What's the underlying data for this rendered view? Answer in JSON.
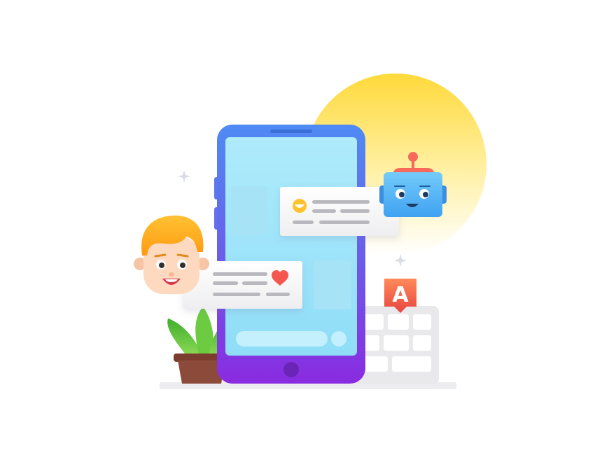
{
  "illustration": {
    "subject": "chatbot-conversation",
    "keyboard_key": {
      "label": "A"
    },
    "message_bot": {
      "emoji": "smile",
      "text_lines": 4
    },
    "message_user": {
      "emoji": "heart",
      "text_lines": 4
    },
    "icons": [
      "smartphone-icon",
      "robot-icon",
      "user-avatar-icon",
      "keyboard-icon",
      "plant-icon",
      "heart-icon",
      "smile-emoji-icon",
      "sparkle-icon"
    ],
    "colors": {
      "sun_top": "#FFD93A",
      "phone_top": "#4F8BF4",
      "phone_bottom": "#8A2BE0",
      "screen": "#9FE6FA",
      "robot_head": "#56B8F7",
      "robot_ear": "#F76A5B",
      "hair": "#FFA318",
      "skin": "#FDD9BF",
      "heart": "#F5564F",
      "key_marker": "#F25A4A",
      "leaves": "#5CC43B",
      "pot": "#8C4A3A"
    }
  }
}
